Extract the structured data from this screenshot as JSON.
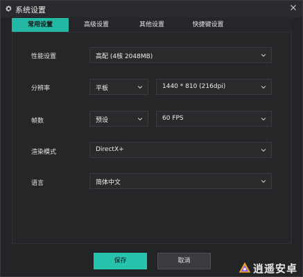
{
  "window": {
    "title": "系统设置"
  },
  "tabs": [
    {
      "label": "常用设置",
      "active": true
    },
    {
      "label": "高级设置",
      "active": false
    },
    {
      "label": "其他设置",
      "active": false
    },
    {
      "label": "快捷键设置",
      "active": false
    }
  ],
  "settings": {
    "performance": {
      "label": "性能设置",
      "value": "高配 (4核 2048MB)"
    },
    "resolution": {
      "label": "分辨率",
      "device": "平板",
      "value": "1440 * 810 (216dpi)"
    },
    "fps": {
      "label": "帧数",
      "preset": "预设",
      "value": "60 FPS"
    },
    "render": {
      "label": "渲染模式",
      "value": "DirectX+"
    },
    "language": {
      "label": "语言",
      "value": "简体中文"
    }
  },
  "buttons": {
    "save": "保存",
    "cancel": "取消"
  },
  "watermark": {
    "text": "逍遥安卓"
  },
  "colors": {
    "accent": "#23b8a3",
    "background": "#232426"
  },
  "icons": {
    "title": "gear-icon",
    "close": "close-icon",
    "dropdown": "chevron-down-icon"
  }
}
